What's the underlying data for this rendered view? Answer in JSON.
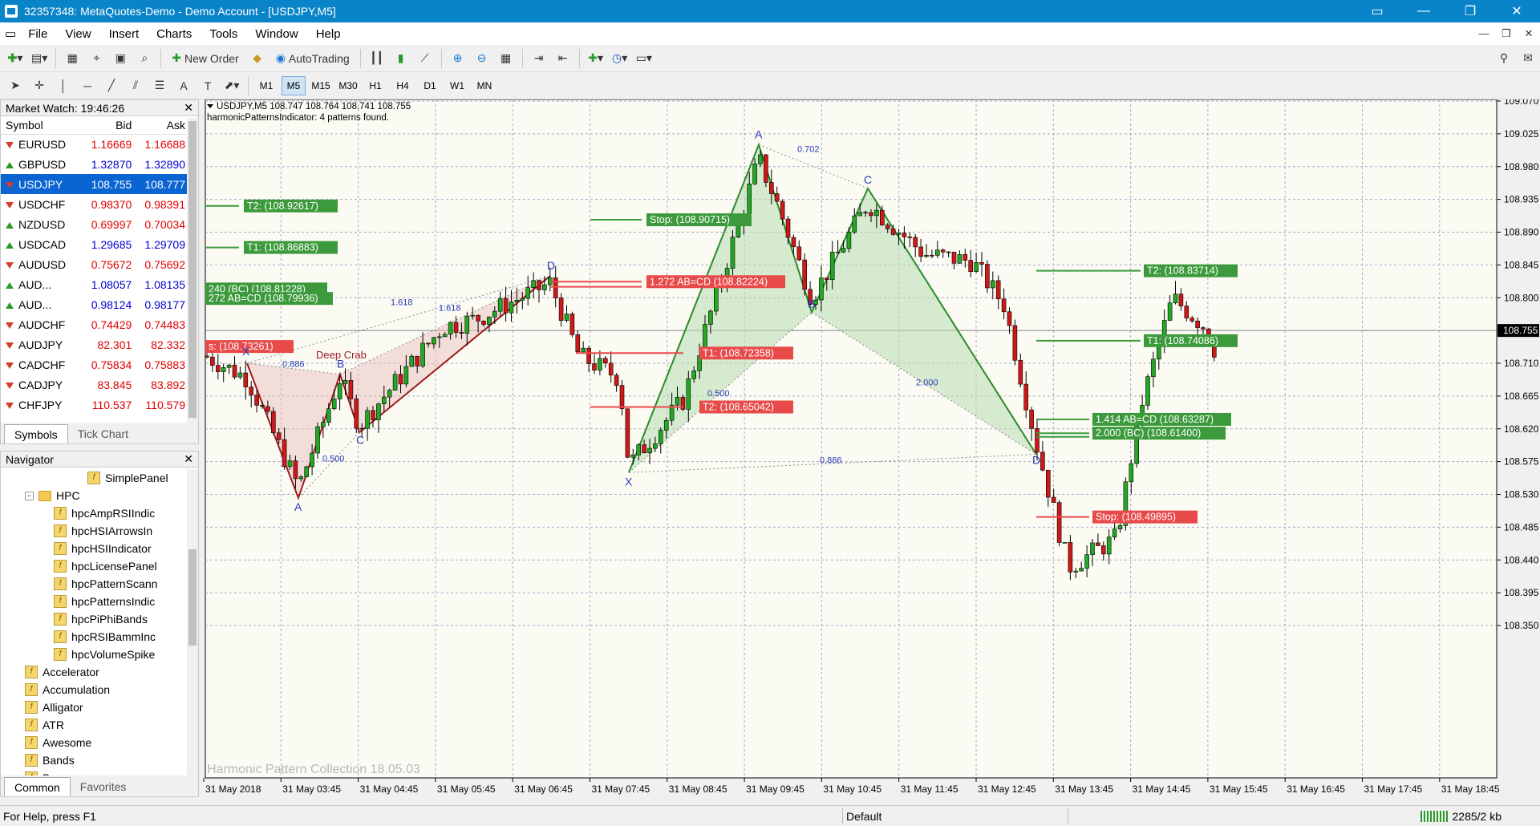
{
  "window": {
    "title": "32357348: MetaQuotes-Demo - Demo Account - [USDJPY,M5]"
  },
  "menu": [
    "File",
    "View",
    "Insert",
    "Charts",
    "Tools",
    "Window",
    "Help"
  ],
  "toolbar": {
    "new_order": "New Order",
    "autotrading": "AutoTrading"
  },
  "timeframes": [
    "M1",
    "M5",
    "M15",
    "M30",
    "H1",
    "H4",
    "D1",
    "W1",
    "MN"
  ],
  "active_timeframe": "M5",
  "market_watch": {
    "title": "Market Watch: 19:46:26",
    "columns": [
      "Symbol",
      "Bid",
      "Ask"
    ],
    "rows": [
      {
        "symbol": "EURUSD",
        "bid": "1.16669",
        "ask": "1.16688",
        "dir": "down",
        "color": "red"
      },
      {
        "symbol": "GBPUSD",
        "bid": "1.32870",
        "ask": "1.32890",
        "dir": "up",
        "color": "blue"
      },
      {
        "symbol": "USDJPY",
        "bid": "108.755",
        "ask": "108.777",
        "dir": "down",
        "color": "sel"
      },
      {
        "symbol": "USDCHF",
        "bid": "0.98370",
        "ask": "0.98391",
        "dir": "down",
        "color": "red"
      },
      {
        "symbol": "NZDUSD",
        "bid": "0.69997",
        "ask": "0.70034",
        "dir": "up",
        "color": "red"
      },
      {
        "symbol": "USDCAD",
        "bid": "1.29685",
        "ask": "1.29709",
        "dir": "up",
        "color": "blue"
      },
      {
        "symbol": "AUDUSD",
        "bid": "0.75672",
        "ask": "0.75692",
        "dir": "down",
        "color": "red"
      },
      {
        "symbol": "AUD...",
        "bid": "1.08057",
        "ask": "1.08135",
        "dir": "up",
        "color": "blue"
      },
      {
        "symbol": "AUD...",
        "bid": "0.98124",
        "ask": "0.98177",
        "dir": "up",
        "color": "blue"
      },
      {
        "symbol": "AUDCHF",
        "bid": "0.74429",
        "ask": "0.74483",
        "dir": "down",
        "color": "red"
      },
      {
        "symbol": "AUDJPY",
        "bid": "82.301",
        "ask": "82.332",
        "dir": "down",
        "color": "red"
      },
      {
        "symbol": "CADCHF",
        "bid": "0.75834",
        "ask": "0.75883",
        "dir": "down",
        "color": "red"
      },
      {
        "symbol": "CADJPY",
        "bid": "83.845",
        "ask": "83.892",
        "dir": "down",
        "color": "red"
      },
      {
        "symbol": "CHFJPY",
        "bid": "110.537",
        "ask": "110.579",
        "dir": "down",
        "color": "red"
      }
    ],
    "tabs": [
      "Symbols",
      "Tick Chart"
    ]
  },
  "navigator": {
    "title": "Navigator",
    "items": [
      {
        "label": "SimplePanel",
        "level": 3,
        "kind": "ind"
      },
      {
        "label": "HPC",
        "level": 1,
        "kind": "folder"
      },
      {
        "label": "hpcAmpRSIIndic",
        "level": 2,
        "kind": "ind"
      },
      {
        "label": "hpcHSIArrowsIn",
        "level": 2,
        "kind": "ind"
      },
      {
        "label": "hpcHSIIndicator",
        "level": 2,
        "kind": "ind"
      },
      {
        "label": "hpcLicensePanel",
        "level": 2,
        "kind": "ind"
      },
      {
        "label": "hpcPatternScann",
        "level": 2,
        "kind": "ind"
      },
      {
        "label": "hpcPatternsIndic",
        "level": 2,
        "kind": "ind"
      },
      {
        "label": "hpcPiPhiBands",
        "level": 2,
        "kind": "ind"
      },
      {
        "label": "hpcRSIBammInc",
        "level": 2,
        "kind": "ind"
      },
      {
        "label": "hpcVolumeSpike",
        "level": 2,
        "kind": "ind"
      },
      {
        "label": "Accelerator",
        "level": 1,
        "kind": "ind"
      },
      {
        "label": "Accumulation",
        "level": 1,
        "kind": "ind"
      },
      {
        "label": "Alligator",
        "level": 1,
        "kind": "ind"
      },
      {
        "label": "ATR",
        "level": 1,
        "kind": "ind"
      },
      {
        "label": "Awesome",
        "level": 1,
        "kind": "ind"
      },
      {
        "label": "Bands",
        "level": 1,
        "kind": "ind"
      },
      {
        "label": "Bears",
        "level": 1,
        "kind": "ind"
      }
    ],
    "tabs": [
      "Common",
      "Favorites"
    ]
  },
  "chart": {
    "header": "USDJPY,M5  108.747 108.764 108.741 108.755",
    "indicator_line": "harmonicPatternsIndicator: 4 patterns found.",
    "watermark": "Harmonic Pattern Collection 18.05.03",
    "current_price": "108.755",
    "price_labels": [
      "109.070",
      "109.025",
      "108.980",
      "108.935",
      "108.890",
      "108.845",
      "108.800",
      "108.755",
      "108.710",
      "108.665",
      "108.620",
      "108.575",
      "108.530",
      "108.485",
      "108.440",
      "108.395",
      "108.350"
    ],
    "time_labels": [
      "31 May 2018",
      "31 May 03:45",
      "31 May 04:45",
      "31 May 05:45",
      "31 May 06:45",
      "31 May 07:45",
      "31 May 08:45",
      "31 May 09:45",
      "31 May 10:45",
      "31 May 11:45",
      "31 May 12:45",
      "31 May 13:45",
      "31 May 14:45",
      "31 May 15:45",
      "31 May 16:45",
      "31 May 17:45",
      "31 May 18:45"
    ],
    "annotations": {
      "deep_crab": "Deep Crab",
      "ratios": [
        "0.886",
        "1.618",
        "1.618",
        "0.500",
        "0.702",
        "0.500",
        "2.000",
        "0.886"
      ],
      "point_labels": [
        "X",
        "A",
        "B",
        "C",
        "D"
      ],
      "t2_left": "T2: (108.92617)",
      "t1_left": "T1: (108.86883)",
      "bc_left": "240 (BC) (108.81228)",
      "abcd_left": "272 AB=CD (108.79936)",
      "stop_left": "s: (108.73261)",
      "stop_mid": "Stop: (108.90715)",
      "abcd_mid": "1.272 AB=CD (108.82224)",
      "t1_mid": "T1: (108.72358)",
      "t2_mid": "T2: (108.65042)",
      "t2_right": "T2: (108.83714)",
      "t1_right": "T1: (108.74086)",
      "abcd_right": "1.414 AB=CD (108.63287)",
      "bc_right": "2.000 (BC) (108.61400)",
      "stop_right": "Stop: (108.49895)"
    }
  },
  "status": {
    "help": "For Help, press F1",
    "profile": "Default",
    "traffic": "2285/2 kb"
  }
}
